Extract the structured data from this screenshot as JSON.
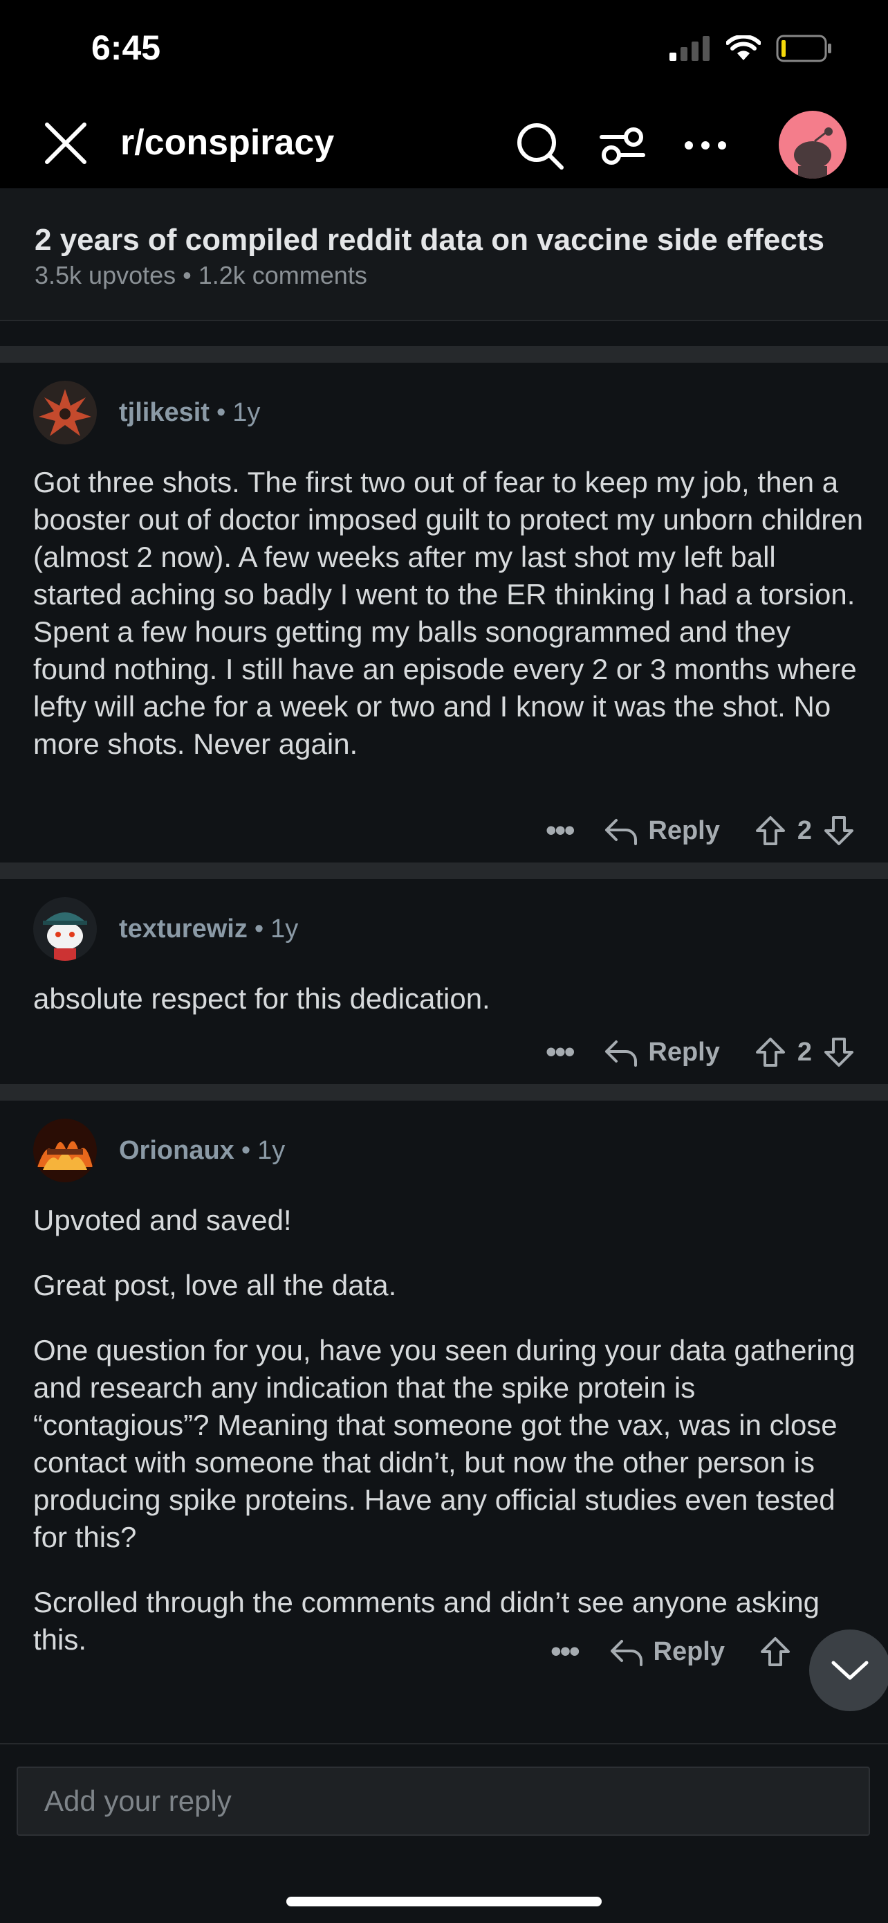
{
  "status_bar": {
    "time": "6:45"
  },
  "nav": {
    "subreddit": "r/conspiracy"
  },
  "post": {
    "title": "2 years of compiled reddit data on vaccine side effects",
    "meta": "3.5k upvotes • 1.2k comments"
  },
  "comments": [
    {
      "user": "tjlikesit",
      "age": "1y",
      "paragraphs": [
        "Got three shots. The first two out of fear to keep my job, then a booster out of doctor imposed guilt to protect my unborn children (almost 2 now). A few weeks after my last shot my left ball started aching so badly I went to the ER thinking I had a torsion. Spent a few hours getting my balls sonogrammed and they found nothing. I still have an episode every 2 or 3 months where lefty will ache for a week or two and I know it was the shot. No more shots. Never again."
      ],
      "reply_label": "Reply",
      "votes": "2"
    },
    {
      "user": "texturewiz",
      "age": "1y",
      "paragraphs": [
        "absolute respect for this dedication."
      ],
      "reply_label": "Reply",
      "votes": "2"
    },
    {
      "user": "Orionaux",
      "age": "1y",
      "paragraphs": [
        "Upvoted and saved!",
        "Great post, love all the data.",
        "One question for you, have you seen during your data gathering and research any indication that the spike protein is “contagious”? Meaning that someone got the vax, was in close contact with someone that didn’t, but now the other person is producing spike proteins. Have any official studies even tested for this?",
        "Scrolled through the comments and didn’t see anyone asking this."
      ],
      "reply_label": "Reply"
    }
  ],
  "reply_input": {
    "placeholder": "Add your reply"
  }
}
